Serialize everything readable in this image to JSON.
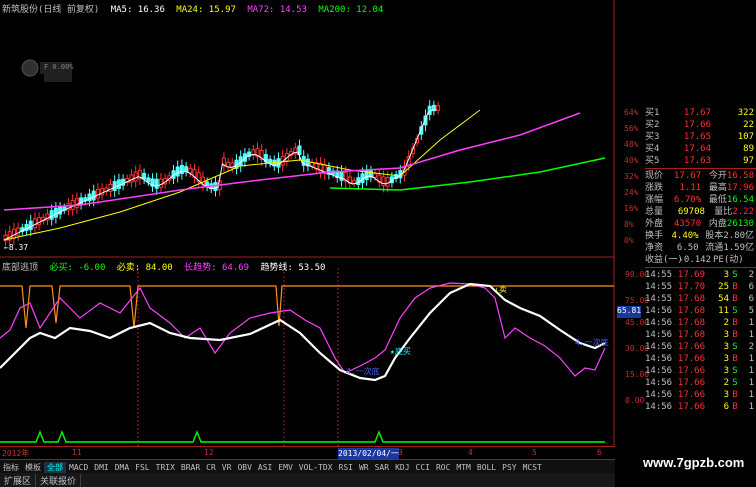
{
  "main": {
    "title": "新筑股份(日线 前复权)",
    "ma": [
      {
        "label": "MA5: 16.36",
        "color": "#ffffff"
      },
      {
        "label": "MA24: 15.97",
        "color": "#ffff00"
      },
      {
        "label": "MA72: 14.53",
        "color": "#ff40ff"
      },
      {
        "label": "MA200: 12.04",
        "color": "#00ff00"
      }
    ],
    "low_marker": "←8.37",
    "axis": [
      "64%",
      "56%",
      "48%",
      "40%",
      "32%",
      "24%",
      "16%",
      "8%",
      "0%"
    ],
    "watermark": "F 0.00%"
  },
  "indicator": {
    "title": "底部逃顶",
    "items": [
      {
        "label": "必买: -6.00",
        "color": "#00ff00"
      },
      {
        "label": "必卖: 84.00",
        "color": "#ffff00"
      },
      {
        "label": "长趋势: 64.69",
        "color": "#ff40ff"
      },
      {
        "label": "趋势线: 53.50",
        "color": "#ffffff"
      }
    ],
    "axis": [
      "90.00",
      "75.00",
      "65.81",
      "45.00",
      "30.00",
      "15.00",
      "0.00"
    ],
    "current": "65.81",
    "annotations": {
      "sell": "↓卖",
      "buy": "★底买",
      "bottom1": "4.一次底",
      "bottom2": "4.一次底"
    }
  },
  "time_axis": [
    "2012年",
    "11",
    "12",
    "2013/02/04/一",
    "3",
    "4",
    "5",
    "6"
  ],
  "tabs": [
    "指标",
    "模板",
    "全部",
    "MACD",
    "DMI",
    "DMA",
    "FSL",
    "TRIX",
    "BRAR",
    "CR",
    "VR",
    "OBV",
    "ASI",
    "EMV",
    "VOL-TDX",
    "RSI",
    "WR",
    "SAR",
    "KDJ",
    "CCI",
    "ROC",
    "MTM",
    "BOLL",
    "PSY",
    "MCST"
  ],
  "active_tab": "全部",
  "bottom": [
    "扩展区",
    "关联报价"
  ],
  "quote": {
    "buy_orders": [
      {
        "label": "买1",
        "price": "17.67",
        "vol": "322"
      },
      {
        "label": "买2",
        "price": "17.66",
        "vol": "22"
      },
      {
        "label": "买3",
        "price": "17.65",
        "vol": "107"
      },
      {
        "label": "买4",
        "price": "17.64",
        "vol": "89"
      },
      {
        "label": "买5",
        "price": "17.63",
        "vol": "97"
      }
    ],
    "stats": [
      {
        "k1": "现价",
        "v1": "17.67",
        "k2": "今开",
        "v2": "16.58",
        "c1": "#ff3030",
        "c2": "#ff3030"
      },
      {
        "k1": "涨跌",
        "v1": "1.11",
        "k2": "最高",
        "v2": "17.96",
        "c1": "#ff3030",
        "c2": "#ff3030"
      },
      {
        "k1": "涨幅",
        "v1": "6.70%",
        "k2": "最低",
        "v2": "16.54",
        "c1": "#ff3030",
        "c2": "#00ff00"
      },
      {
        "k1": "总量",
        "v1": "69708",
        "k2": "量比",
        "v2": "2.22",
        "c1": "#ffff00",
        "c2": "#ff3030"
      },
      {
        "k1": "外盘",
        "v1": "43570",
        "k2": "内盘",
        "v2": "26130",
        "c1": "#ff3030",
        "c2": "#00ff00"
      },
      {
        "k1": "换手",
        "v1": "4.40%",
        "k2": "股本",
        "v2": "2.80亿",
        "c1": "#ffff00",
        "c2": "#c0c0c0"
      },
      {
        "k1": "净资",
        "v1": "6.50",
        "k2": "流通",
        "v2": "1.59亿",
        "c1": "#c0c0c0",
        "c2": "#c0c0c0"
      },
      {
        "k1": "收益(一)",
        "v1": "-0.142",
        "k2": "PE(动)",
        "v2": "",
        "c1": "#c0c0c0",
        "c2": "#c0c0c0"
      }
    ],
    "ticks": [
      {
        "t": "14:55",
        "p": "17.69",
        "v": "3",
        "s": "S",
        "sc": "#00ff00",
        "n": "2"
      },
      {
        "t": "14:55",
        "p": "17.70",
        "v": "25",
        "s": "B",
        "sc": "#ff3030",
        "n": "6"
      },
      {
        "t": "14:55",
        "p": "17.68",
        "v": "54",
        "s": "B",
        "sc": "#ff3030",
        "n": "6"
      },
      {
        "t": "14:56",
        "p": "17.68",
        "v": "11",
        "s": "S",
        "sc": "#00ff00",
        "n": "5"
      },
      {
        "t": "14:56",
        "p": "17.68",
        "v": "2",
        "s": "B",
        "sc": "#ff3030",
        "n": "1"
      },
      {
        "t": "14:56",
        "p": "17.68",
        "v": "3",
        "s": "B",
        "sc": "#ff3030",
        "n": "1"
      },
      {
        "t": "14:56",
        "p": "17.66",
        "v": "3",
        "s": "S",
        "sc": "#00ff00",
        "n": "2"
      },
      {
        "t": "14:56",
        "p": "17.66",
        "v": "3",
        "s": "B",
        "sc": "#ff3030",
        "n": "1"
      },
      {
        "t": "14:56",
        "p": "17.66",
        "v": "3",
        "s": "S",
        "sc": "#00ff00",
        "n": "1"
      },
      {
        "t": "14:56",
        "p": "17.66",
        "v": "2",
        "s": "S",
        "sc": "#00ff00",
        "n": "1"
      },
      {
        "t": "14:56",
        "p": "17.66",
        "v": "3",
        "s": "B",
        "sc": "#ff3030",
        "n": "1"
      },
      {
        "t": "14:56",
        "p": "17.66",
        "v": "6",
        "s": "B",
        "sc": "#ff3030",
        "n": "1"
      }
    ]
  },
  "watermark_site": "www.7gpzb.com"
}
